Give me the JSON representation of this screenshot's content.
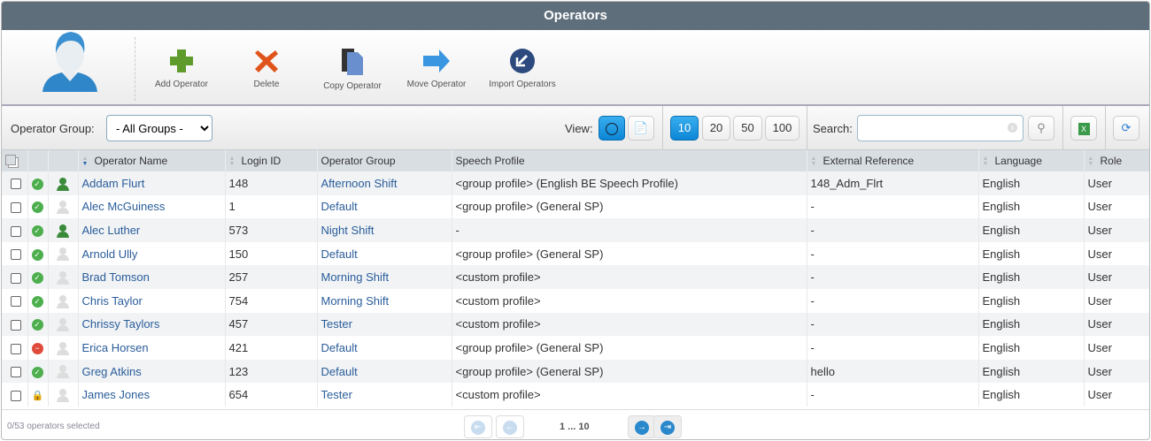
{
  "title": "Operators",
  "toolbar": {
    "add": "Add Operator",
    "delete": "Delete",
    "copy": "Copy Operator",
    "move": "Move Operator",
    "import": "Import Operators"
  },
  "filter": {
    "group_label": "Operator Group:",
    "group_value": "- All Groups -",
    "view_label": "View:",
    "page_sizes": [
      "10",
      "20",
      "50",
      "100"
    ],
    "selected_page_size": "10",
    "search_label": "Search:",
    "search_value": ""
  },
  "columns": [
    "Operator Name",
    "Login ID",
    "Operator Group",
    "Speech Profile",
    "External Reference",
    "Language",
    "Role"
  ],
  "rows": [
    {
      "name": "Addam Flurt",
      "login": "148",
      "group": "Afternoon Shift",
      "speech": "<group profile> (English BE Speech Profile)",
      "ext": "148_Adm_Flrt",
      "lang": "English",
      "role": "User",
      "status": "active",
      "person": "green"
    },
    {
      "name": "Alec McGuiness",
      "login": "1",
      "group": "Default",
      "speech": "<group profile> (General SP)",
      "ext": "-",
      "lang": "English",
      "role": "User",
      "status": "active",
      "person": "grey"
    },
    {
      "name": "Alec Luther",
      "login": "573",
      "group": "Night Shift",
      "speech": "-",
      "ext": "-",
      "lang": "English",
      "role": "User",
      "status": "active",
      "person": "green"
    },
    {
      "name": "Arnold Ully",
      "login": "150",
      "group": "Default",
      "speech": "<group profile> (General SP)",
      "ext": "-",
      "lang": "English",
      "role": "User",
      "status": "active",
      "person": "grey"
    },
    {
      "name": "Brad Tomson",
      "login": "257",
      "group": "Morning Shift",
      "speech": "<custom profile>",
      "ext": "-",
      "lang": "English",
      "role": "User",
      "status": "active",
      "person": "grey"
    },
    {
      "name": "Chris Taylor",
      "login": "754",
      "group": "Morning Shift",
      "speech": "<custom profile>",
      "ext": "-",
      "lang": "English",
      "role": "User",
      "status": "active",
      "person": "grey"
    },
    {
      "name": "Chrissy Taylors",
      "login": "457",
      "group": "Tester",
      "speech": "<custom profile>",
      "ext": "-",
      "lang": "English",
      "role": "User",
      "status": "active",
      "person": "grey"
    },
    {
      "name": "Erica Horsen",
      "login": "421",
      "group": "Default",
      "speech": "<group profile> (General SP)",
      "ext": "-",
      "lang": "English",
      "role": "User",
      "status": "disabled",
      "person": "grey"
    },
    {
      "name": "Greg Atkins",
      "login": "123",
      "group": "Default",
      "speech": "<group profile> (General SP)",
      "ext": "hello",
      "lang": "English",
      "role": "User",
      "status": "active",
      "person": "grey"
    },
    {
      "name": "James Jones",
      "login": "654",
      "group": "Tester",
      "speech": "<custom profile>",
      "ext": "-",
      "lang": "English",
      "role": "User",
      "status": "locked",
      "person": "grey"
    }
  ],
  "footer": {
    "selected": "0/53 operators selected",
    "pages": "1 ... 10"
  }
}
